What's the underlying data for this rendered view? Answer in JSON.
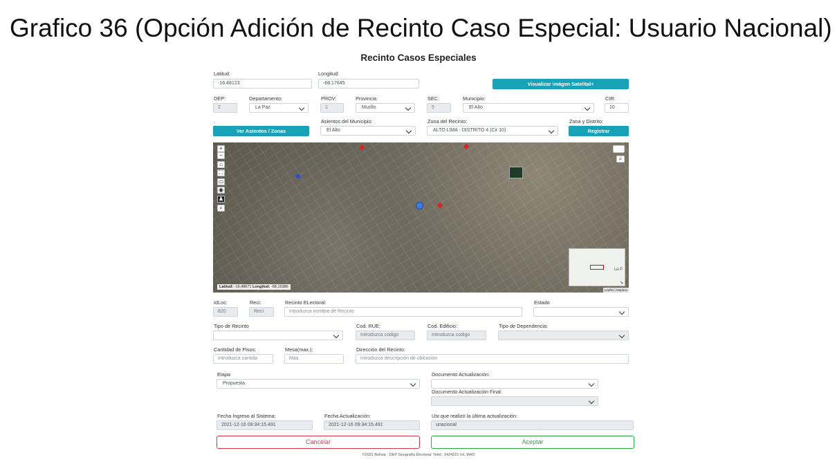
{
  "slide_title": "Grafico 36 (Opción Adición de Recinto Caso Especial: Usuario Nacional)",
  "form_title": "Recinto Casos Especiales",
  "row1": {
    "latitud_label": "Latitud:",
    "latitud_value": "-16.48123",
    "longitud_label": "Longitud:",
    "longitud_value": "-68.17645",
    "dot_label": ".",
    "satelital_button": "Visualizar imágen Satelital+"
  },
  "row2": {
    "dep_label": "DEP:",
    "dep_value": "2",
    "departamento_label": "Departamento:",
    "departamento_value": "La Paz",
    "prov_label": "PROV:",
    "prov_value": "1",
    "provincia_label": "Provincia:",
    "provincia_value": "Murillo",
    "sec_label": "SEC:",
    "sec_value": "5",
    "municipio_label": "Municipio:",
    "municipio_value": "El Alto",
    "cir_label": "CIR:",
    "cir_value": "10"
  },
  "row3": {
    "dot_label": ".",
    "asientos_button": "Ver Asientos / Zonas",
    "asientos_label": "Asientos del Municipio:",
    "asientos_value": "El Alto",
    "zona_label": "Zona del Recinto:",
    "zona_value": "ALTO LIMA - DISTRITO 4 (Cir 10)",
    "zona_distrito_label": "Zona y Distrito:",
    "registrar_button": "Registrar"
  },
  "map": {
    "coords_label_lat": "Latitud:",
    "coords_lat": "-16,48671",
    "coords_label_lon": "Longitud:",
    "coords_lon": "-68,16386",
    "minimap_text": "La P",
    "attribution": "Leaflet | Mapbox",
    "zoom_in": "+",
    "zoom_out": "−",
    "icons": [
      "plus-icon",
      "minus-icon",
      "home-icon",
      "fullscreen-icon",
      "ruler-icon",
      "location-pin-icon",
      "person-icon",
      "search-icon",
      "layers-icon"
    ]
  },
  "row4": {
    "idloc_label": "IdLoc:",
    "idloc_value": "820",
    "reci_label": "Reci:",
    "reci_value": "Reci",
    "recinto_label": "Recinto ELectoral:",
    "recinto_placeholder": "Introduzca nombre de Recinto",
    "estado_label": "Estado",
    "estado_value": ""
  },
  "row5": {
    "tipo_label": "Tipo de Recinto",
    "tipo_value": "",
    "rue_label": "Cod. RUE:",
    "rue_placeholder": "Introduzca codigo",
    "edificio_label": "Cod. Edificio:",
    "edificio_placeholder": "Introduzca codigo",
    "dependencia_label": "Tipo de Dependencia:",
    "dependencia_value": ""
  },
  "row6": {
    "pisos_label": "Cantidad de Pisos:",
    "pisos_placeholder": "Introduzca cantida",
    "mesa_label": "Mesa(max.):",
    "mesa_placeholder": "Max.",
    "direccion_label": "Dirección del Recinto:",
    "direccion_placeholder": "Introduzca descripción de ubicación"
  },
  "row7": {
    "etapa_label": "Etapa",
    "etapa_value": "Propuesta",
    "doc_label": "Documento Actualización:",
    "doc_value": "",
    "doc_final_label": "Documento Actualización Final:",
    "doc_final_value": ""
  },
  "row8": {
    "ingreso_label": "Fecha Ingreso al Sistema:",
    "ingreso_value": "2021-12-16 09:34:15.491",
    "actualizacion_label": "Fecha Actualización:",
    "actualizacion_value": "2021-12-16 09:34:15.491",
    "usuario_label": "Usr.que realizó la última actualización:",
    "usuario_value": "unacional"
  },
  "actions": {
    "cancel": "Cancelar",
    "accept": "Aceptar"
  },
  "footer": "©2021 Bolivia  ·  OEP Geografía Electoral: Telef.: 2424221 Int. 9943",
  "colors": {
    "teal": "#17a2b8",
    "cancel": "#dc3545",
    "accept": "#28a745"
  }
}
